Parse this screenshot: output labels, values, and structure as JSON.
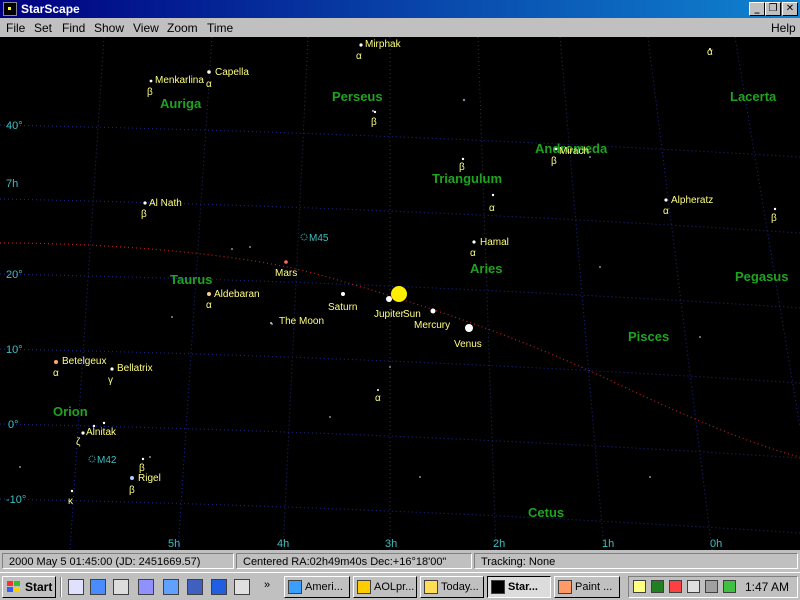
{
  "window": {
    "title": "StarScape",
    "minimize": "_",
    "maximize": "❐",
    "close": "✕"
  },
  "menu": [
    "File",
    "Set",
    "Find",
    "Show",
    "View",
    "Zoom",
    "Time"
  ],
  "help": "Help",
  "colors": {
    "sky": "#000000",
    "grid": "#1e2a8a",
    "ecliptic": "#c02020",
    "constellation": "#1fa31f",
    "star_label": "#ffff80",
    "axis_label": "#3fbfbf",
    "planet": "#ffff00",
    "sun": "#ffee00",
    "moon": "#ffffff"
  },
  "sky": {
    "ra_labels": [
      {
        "text": "5h",
        "ra": 5
      },
      {
        "text": "4h",
        "ra": 4
      },
      {
        "text": "3h",
        "ra": 3
      },
      {
        "text": "2h",
        "ra": 2
      },
      {
        "text": "1h",
        "ra": 1
      },
      {
        "text": "0h",
        "ra": 0
      },
      {
        "text": "7h",
        "ra": 7
      }
    ],
    "dec_labels": [
      {
        "text": "40°",
        "dec": 40
      },
      {
        "text": "20°",
        "dec": 20
      },
      {
        "text": "10°",
        "dec": 10
      },
      {
        "text": "0°",
        "dec": 0
      },
      {
        "text": "-10°",
        "dec": -10
      }
    ],
    "constellations": [
      "Perseus",
      "Auriga",
      "Lacerta",
      "Andromeda",
      "Triangulum",
      "Aries",
      "Taurus",
      "Pegasus",
      "Pisces",
      "Orion",
      "Cetus"
    ],
    "stars": [
      {
        "name": "Mirphak",
        "greek": "α"
      },
      {
        "name": "Capella",
        "greek": "α"
      },
      {
        "name": "Menkarlina",
        "greek": "β"
      },
      {
        "name": "Mirach",
        "greek": "β"
      },
      {
        "name": "Al Nath",
        "greek": "β"
      },
      {
        "name": "Alpheratz",
        "greek": "α"
      },
      {
        "name": "Hamal",
        "greek": "α"
      },
      {
        "name": "Aldebaran",
        "greek": "α"
      },
      {
        "name": "Betelgeux",
        "greek": "α"
      },
      {
        "name": "Bellatrix",
        "greek": "γ"
      },
      {
        "name": "Alnitak",
        "greek": "ζ"
      },
      {
        "name": "Rigel",
        "greek": "β"
      },
      {
        "name": "",
        "greek": "β"
      },
      {
        "name": "",
        "greek": "α"
      },
      {
        "name": "",
        "greek": "β"
      },
      {
        "name": "",
        "greek": "α"
      },
      {
        "name": "",
        "greek": "α"
      },
      {
        "name": "",
        "greek": "β"
      },
      {
        "name": "",
        "greek": "κ"
      },
      {
        "name": "",
        "greek": "β"
      }
    ],
    "deep_sky": [
      "M45",
      "M42"
    ],
    "planets": [
      "Mars",
      "Saturn",
      "Jupiter",
      "Sun",
      "Mercury",
      "Venus",
      "The Moon"
    ]
  },
  "status": {
    "datetime": "2000 May 5    01:45:00    (JD: 2451669.57)",
    "centered": "Centered  RA:02h49m40s  Dec:+16°18'00\"",
    "tracking": "Tracking: None"
  },
  "taskbar": {
    "start": "Start",
    "tasks": [
      "Ameri...",
      "AOLpr...",
      "Today...",
      "Star...",
      "Paint ..."
    ],
    "active_task": "Star...",
    "more": "»",
    "clock": "1:47 AM"
  }
}
